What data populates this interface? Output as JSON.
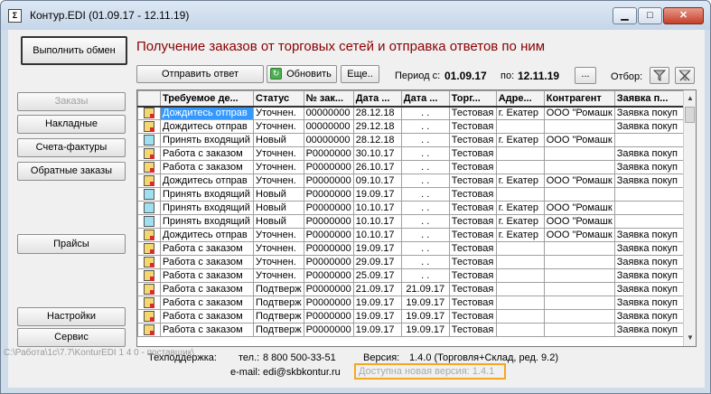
{
  "window": {
    "title": "Контур.EDI (01.09.17 - 12.11.19)",
    "app_icon": "Σ",
    "min_label": "▁",
    "max_label": "□",
    "close_label": "✕"
  },
  "left_panel": {
    "exchange_button": "Выполнить обмен",
    "orders_button": "Заказы",
    "invoices_button": "Накладные",
    "schet_button": "Счета-фактуры",
    "return_orders_button": "Обратные заказы",
    "prices_button": "Прайсы",
    "settings_button": "Настройки",
    "service_button": "Сервис"
  },
  "header": {
    "title": "Получение заказов от торговых сетей и отправка ответов по ним",
    "send_button": "Отправить ответ",
    "refresh_button": "Обновить",
    "more_button": "Еще..",
    "period_label": "Период с:",
    "period_from": "01.09.17",
    "period_to_label": "по:",
    "period_to": "12.11.19",
    "ellipsis_button": "...",
    "filter_label": "Отбор:"
  },
  "table": {
    "columns": [
      "",
      "Требуемое де...",
      "Статус",
      "№ зак...",
      "Дата ...",
      "Дата ...",
      "Торг...",
      "Адре...",
      "Контрагент",
      "Заявка п..."
    ],
    "rows": [
      {
        "icon": "work",
        "action": "Дождитесь отправ",
        "status": "Уточнен.",
        "num": "00000000",
        "date1": "28.12.18",
        "date2": ". .",
        "shop": "Тестовая",
        "addr": "г. Екатер",
        "contr": "ООО \"Ромашк",
        "req": "Заявка покуп"
      },
      {
        "icon": "work",
        "action": "Дождитесь отправ",
        "status": "Уточнен.",
        "num": "00000000",
        "date1": "29.12.18",
        "date2": ". .",
        "shop": "Тестовая",
        "addr": "",
        "contr": "",
        "req": "Заявка покуп"
      },
      {
        "icon": "plain",
        "action": "Принять входящий",
        "status": "Новый",
        "num": "00000000",
        "date1": "28.12.18",
        "date2": ". .",
        "shop": "Тестовая",
        "addr": "г. Екатер",
        "contr": "ООО \"Ромашк",
        "req": ""
      },
      {
        "icon": "work",
        "action": "Работа с заказом",
        "status": "Уточнен.",
        "num": "Р0000000",
        "date1": "30.10.17",
        "date2": ". .",
        "shop": "Тестовая",
        "addr": "",
        "contr": "",
        "req": "Заявка покуп"
      },
      {
        "icon": "work",
        "action": "Работа с заказом",
        "status": "Уточнен.",
        "num": "Р0000000",
        "date1": "26.10.17",
        "date2": ". .",
        "shop": "Тестовая",
        "addr": "",
        "contr": "",
        "req": "Заявка покуп"
      },
      {
        "icon": "work",
        "action": "Дождитесь отправ",
        "status": "Уточнен.",
        "num": "Р0000000",
        "date1": "09.10.17",
        "date2": ". .",
        "shop": "Тестовая",
        "addr": "г. Екатер",
        "contr": "ООО \"Ромашк",
        "req": "Заявка покуп"
      },
      {
        "icon": "plain",
        "action": "Принять входящий",
        "status": "Новый",
        "num": "Р0000000",
        "date1": "19.09.17",
        "date2": ". .",
        "shop": "Тестовая",
        "addr": "",
        "contr": "",
        "req": ""
      },
      {
        "icon": "plain",
        "action": "Принять входящий",
        "status": "Новый",
        "num": "Р0000000",
        "date1": "10.10.17",
        "date2": ". .",
        "shop": "Тестовая",
        "addr": "г. Екатер",
        "contr": "ООО \"Ромашк",
        "req": ""
      },
      {
        "icon": "plain",
        "action": "Принять входящий",
        "status": "Новый",
        "num": "Р0000000",
        "date1": "10.10.17",
        "date2": ". .",
        "shop": "Тестовая",
        "addr": "г. Екатер",
        "contr": "ООО \"Ромашк",
        "req": ""
      },
      {
        "icon": "work",
        "action": "Дождитесь отправ",
        "status": "Уточнен.",
        "num": "Р0000000",
        "date1": "10.10.17",
        "date2": ". .",
        "shop": "Тестовая",
        "addr": "г. Екатер",
        "contr": "ООО \"Ромашк",
        "req": "Заявка покуп"
      },
      {
        "icon": "work",
        "action": "Работа с заказом",
        "status": "Уточнен.",
        "num": "Р0000000",
        "date1": "19.09.17",
        "date2": ". .",
        "shop": "Тестовая",
        "addr": "",
        "contr": "",
        "req": "Заявка покуп"
      },
      {
        "icon": "work",
        "action": "Работа с заказом",
        "status": "Уточнен.",
        "num": "Р0000000",
        "date1": "29.09.17",
        "date2": ". .",
        "shop": "Тестовая",
        "addr": "",
        "contr": "",
        "req": "Заявка покуп"
      },
      {
        "icon": "work",
        "action": "Работа с заказом",
        "status": "Уточнен.",
        "num": "Р0000000",
        "date1": "25.09.17",
        "date2": ". .",
        "shop": "Тестовая",
        "addr": "",
        "contr": "",
        "req": "Заявка покуп"
      },
      {
        "icon": "work",
        "action": "Работа с заказом",
        "status": "Подтверж",
        "num": "Р0000000",
        "date1": "21.09.17",
        "date2": "21.09.17",
        "shop": "Тестовая",
        "addr": "",
        "contr": "",
        "req": "Заявка покуп"
      },
      {
        "icon": "work",
        "action": "Работа с заказом",
        "status": "Подтверж",
        "num": "Р0000000",
        "date1": "19.09.17",
        "date2": "19.09.17",
        "shop": "Тестовая",
        "addr": "",
        "contr": "",
        "req": "Заявка покуп"
      },
      {
        "icon": "work",
        "action": "Работа с заказом",
        "status": "Подтверж",
        "num": "Р0000000",
        "date1": "19.09.17",
        "date2": "19.09.17",
        "shop": "Тестовая",
        "addr": "",
        "contr": "",
        "req": "Заявка покуп"
      },
      {
        "icon": "work",
        "action": "Работа с заказом",
        "status": "Подтверж",
        "num": "Р0000000",
        "date1": "19.09.17",
        "date2": "19.09.17",
        "shop": "Тестовая",
        "addr": "",
        "contr": "",
        "req": "Заявка покуп"
      }
    ]
  },
  "footer": {
    "support_label": "Техподдержка:",
    "phone_label": "тел.:",
    "phone": "8 800 500-33-51",
    "email_label": "e-mail:",
    "email": "edi@skbkontur.ru",
    "version_label": "Версия:",
    "version": "1.4.0 (Торговля+Склад, ред. 9.2)",
    "update_text": "Доступна новая версия: 1.4.1",
    "path": "C:\\Работа\\1с\\7.7\\KonturEDI 1 4 0 - поставщик\\"
  }
}
